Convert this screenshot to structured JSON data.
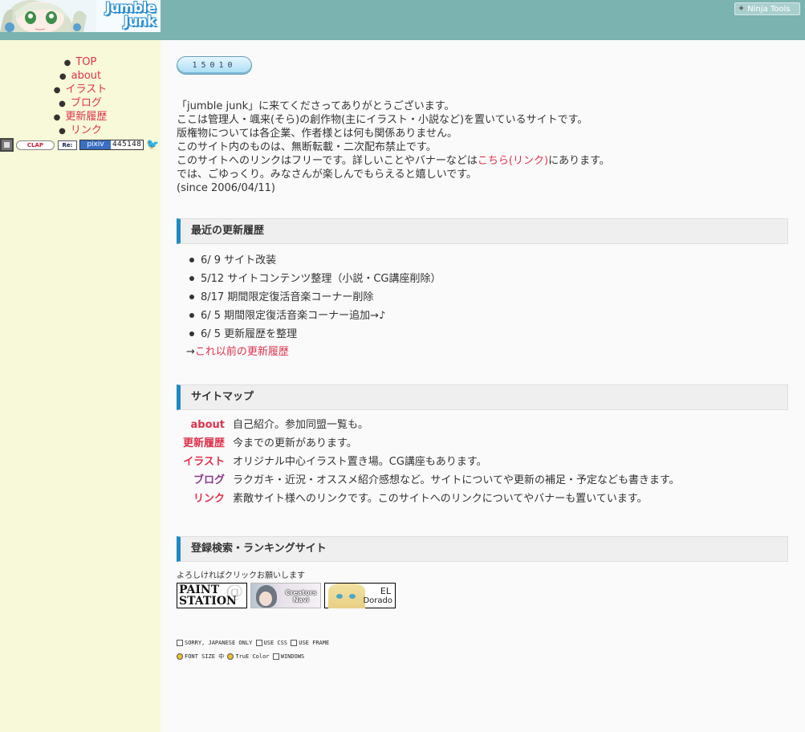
{
  "header": {
    "logo_line1": "Jumble",
    "logo_line2": "Junk",
    "ninja_label": "Ninja Tools"
  },
  "nav": {
    "items": [
      {
        "label": "TOP",
        "color": "#e0314b"
      },
      {
        "label": "about",
        "color": "#e0314b"
      },
      {
        "label": "イラスト",
        "color": "#e0314b"
      },
      {
        "label": "ブログ",
        "color": "#e0314b"
      },
      {
        "label": "更新履歴",
        "color": "#e0314b"
      },
      {
        "label": "リンク",
        "color": "#e0314b"
      }
    ],
    "icons": {
      "clap": "CLAP",
      "re": "Re:",
      "pixiv_label": "pixiv",
      "pixiv_count": "445148"
    }
  },
  "counter": "15010",
  "intro": {
    "line1": "「jumble junk」に来てくださってありがとうございます。",
    "line2": "ここは管理人・颯来(そら)の創作物(主にイラスト・小説など)を置いているサイトです。",
    "line3": "版権物については各企業、作者様とは何も関係ありません。",
    "line4": "このサイト内のものは、無断転載・二次配布禁止です。",
    "line5_pre": "このサイトへのリンクはフリーです。詳しいことやバナーなどは",
    "line5_link": "こちら(リンク)",
    "line5_post": "にあります。",
    "line6": "では、ごゆっくり。みなさんが楽しんでもらえると嬉しいです。",
    "line7": "(since 2006/04/11)"
  },
  "updates": {
    "heading": "最近の更新履歴",
    "items": [
      "6/ 9 サイト改装",
      "5/12 サイトコンテンツ整理（小説・CG講座削除）",
      "8/17 期間限定復活音楽コーナー削除",
      "6/ 5 期間限定復活音楽コーナー追加→♪",
      "6/ 5 更新履歴を整理"
    ],
    "older_arrow": "→",
    "older_link": "これ以前の更新履歴"
  },
  "sitemap": {
    "heading": "サイトマップ",
    "rows": [
      {
        "key": "about",
        "desc": "自己紹介。参加同盟一覧も。",
        "color": "#e0314b"
      },
      {
        "key": "更新履歴",
        "desc": "今までの更新があります。",
        "color": "#e0314b"
      },
      {
        "key": "イラスト",
        "desc": "オリジナル中心イラスト置き場。CG講座もあります。",
        "color": "#e0314b"
      },
      {
        "key": "ブログ",
        "desc": "ラクガキ・近況・オススメ紹介感想など。サイトについてや更新の補足・予定なども書きます。",
        "color": "#8a3a8a"
      },
      {
        "key": "リンク",
        "desc": "素敵サイト様へのリンクです。このサイトへのリンクについてやバナーも置いています。",
        "color": "#e0314b"
      }
    ]
  },
  "ranking": {
    "heading": "登録検索・ランキングサイト",
    "note": "よろしければクリックお願いします",
    "banner1_line1": "PAINT",
    "banner1_line2": "STATION",
    "banner2_line1": "Creators",
    "banner2_line2": "Navi",
    "banner3_line1": "EL",
    "banner3_line2": "Dorado"
  },
  "footer": {
    "row1": [
      "SORRY, JAPANESE ONLY",
      "USE CSS",
      "USE FRAME"
    ],
    "row2": [
      "FONT SIZE 中",
      "TruE Color",
      "WINDOWS"
    ]
  },
  "colors": {
    "header_bg": "#7ab3b0",
    "sidebar_bg": "#f7f9d8",
    "link": "#e0314b",
    "section_accent": "#1e8bc3"
  }
}
